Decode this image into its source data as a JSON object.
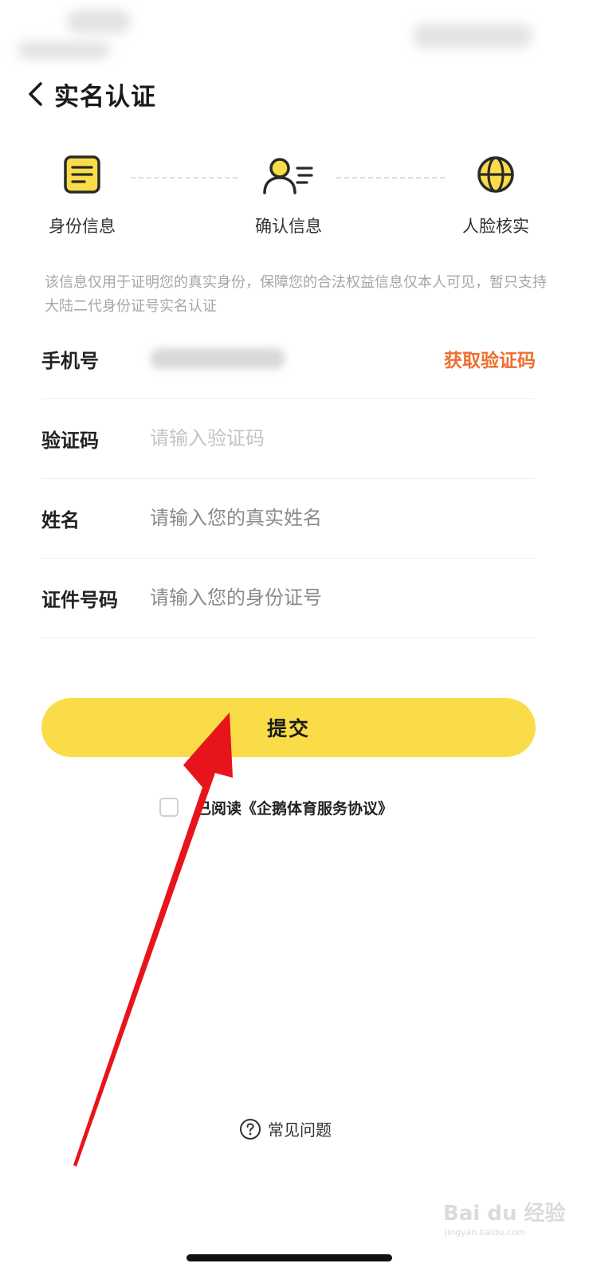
{
  "header": {
    "title": "实名认证",
    "back_icon": "chevron-left-icon"
  },
  "steps": [
    {
      "label": "身份信息",
      "icon": "document-icon"
    },
    {
      "label": "确认信息",
      "icon": "user-info-icon"
    },
    {
      "label": "人脸核实",
      "icon": "face-scan-icon"
    }
  ],
  "notice": "该信息仅用于证明您的真实身份，保障您的合法权益信息仅本人可见，暂只支持大陆二代身份证号实名认证",
  "form": {
    "phone": {
      "label": "手机号",
      "get_code_label": "获取验证码"
    },
    "code": {
      "label": "验证码",
      "placeholder": "请输入验证码"
    },
    "name": {
      "label": "姓名",
      "placeholder": "请输入您的真实姓名"
    },
    "id_number": {
      "label": "证件号码",
      "placeholder": "请输入您的身份证号"
    }
  },
  "submit_label": "提交",
  "agreement": {
    "checked": false,
    "text": "已阅读《企鹅体育服务协议》"
  },
  "faq": {
    "label": "常见问题",
    "icon": "question-circle-icon"
  },
  "watermark": {
    "text": "Bai du 经验",
    "sub": "jingyan.baidu.com"
  },
  "colors": {
    "accent_yellow": "#f9dc48",
    "link_orange": "#ee6f2d",
    "annotation_red": "#e8141b",
    "icon_dark": "#2a2a2a"
  }
}
